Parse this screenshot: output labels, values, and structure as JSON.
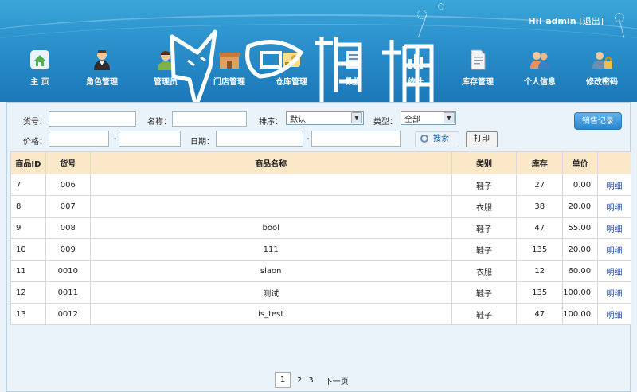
{
  "header": {
    "greeting": "Hi! admin",
    "logout": "[退出]",
    "nav": [
      {
        "label": "主 页",
        "icon": "home-icon",
        "color": "#4caf50"
      },
      {
        "label": "角色管理",
        "icon": "waiter-icon",
        "color": "#8d6e63"
      },
      {
        "label": "管理员",
        "icon": "admin-user-icon",
        "color": "#7cb342"
      },
      {
        "label": "门店管理",
        "icon": "store-icon",
        "color": "#e0a060"
      },
      {
        "label": "仓库管理",
        "icon": "warehouse-icon",
        "color": "#ffcc66"
      },
      {
        "label": "数据",
        "icon": "data-icon",
        "color": "#ffffff"
      },
      {
        "label": "统计",
        "icon": "stats-icon",
        "color": "#ffffff"
      },
      {
        "label": "库存管理",
        "icon": "document-icon",
        "color": "#f5f5f5"
      },
      {
        "label": "个人信息",
        "icon": "people-icon",
        "color": "#ef8f5a"
      },
      {
        "label": "修改密码",
        "icon": "lock-person-icon",
        "color": "#f0c040"
      }
    ],
    "watermark": "偶猫"
  },
  "filters": {
    "code_label": "货号：",
    "name_label": "名称：",
    "sort_label": "排序：",
    "sort_value": "默认",
    "type_label": "类型：",
    "type_value": "全部",
    "price_label": "价格：",
    "price_dash": "-",
    "date_label": "日期：",
    "date_dash": "-",
    "search_label": "搜索",
    "print_label": "打印",
    "sales_label": "销售记录"
  },
  "table": {
    "columns": [
      "商品ID",
      "货号",
      "商品名称",
      "类别",
      "库存",
      "单价",
      ""
    ],
    "rows": [
      {
        "id": "7",
        "code": "006",
        "name": "",
        "category": "鞋子",
        "stock": "27",
        "price": "0.00",
        "action": "明细"
      },
      {
        "id": "8",
        "code": "007",
        "name": "",
        "category": "衣服",
        "stock": "38",
        "price": "20.00",
        "action": "明细"
      },
      {
        "id": "9",
        "code": "008",
        "name": "bool",
        "category": "鞋子",
        "stock": "47",
        "price": "55.00",
        "action": "明细"
      },
      {
        "id": "10",
        "code": "009",
        "name": "111",
        "category": "鞋子",
        "stock": "135",
        "price": "20.00",
        "action": "明细"
      },
      {
        "id": "11",
        "code": "0010",
        "name": "slaon",
        "category": "衣服",
        "stock": "12",
        "price": "60.00",
        "action": "明细"
      },
      {
        "id": "12",
        "code": "0011",
        "name": "测试",
        "category": "鞋子",
        "stock": "135",
        "price": "100.00",
        "action": "明细"
      },
      {
        "id": "13",
        "code": "0012",
        "name": "is_test",
        "category": "鞋子",
        "stock": "47",
        "price": "100.00",
        "action": "明细"
      }
    ]
  },
  "pagination": {
    "pages": [
      "1",
      "2",
      "3"
    ],
    "current": "1",
    "next": "下一页"
  }
}
